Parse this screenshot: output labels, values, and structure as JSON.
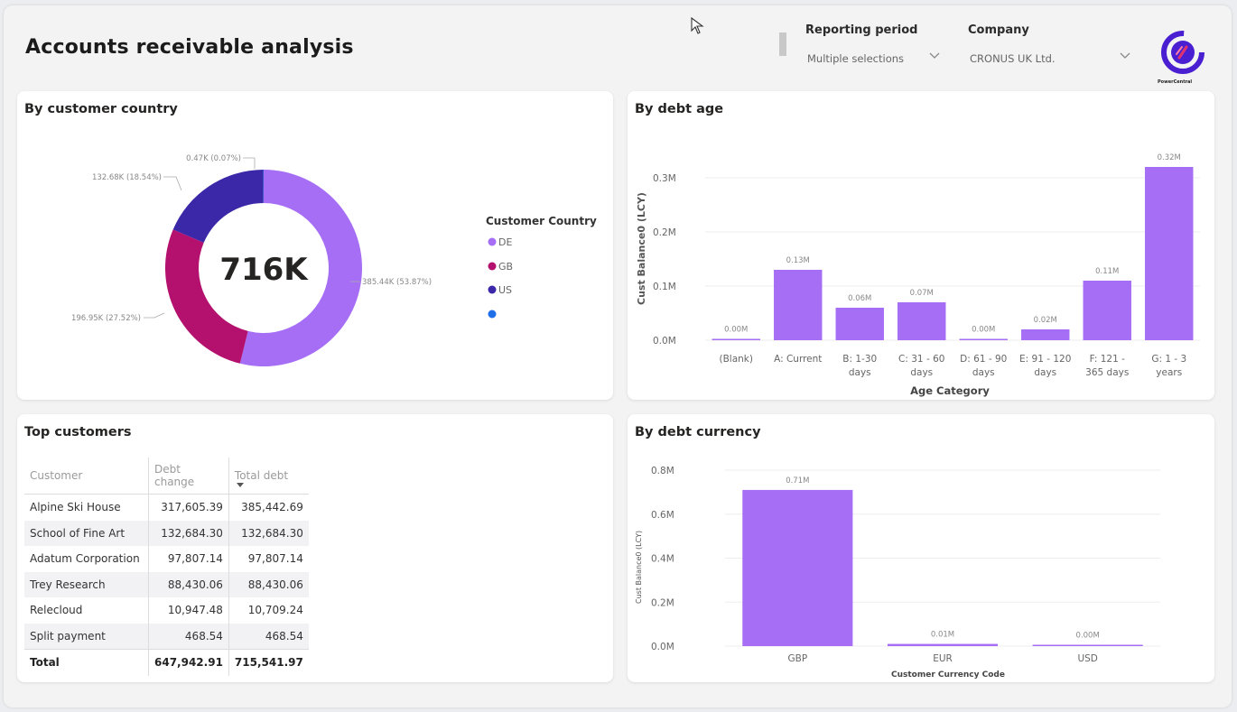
{
  "header": {
    "title": "Accounts receivable analysis",
    "reporting_period": {
      "label": "Reporting period",
      "value": "Multiple selections"
    },
    "company": {
      "label": "Company",
      "value": "CRONUS UK Ltd."
    },
    "logo_text": "PowerCentral"
  },
  "country_card": {
    "title": "By customer country",
    "center_value": "716K",
    "legend_title": "Customer Country",
    "legend": [
      {
        "label": "DE",
        "color": "#a66ef5"
      },
      {
        "label": "GB",
        "color": "#b4106e"
      },
      {
        "label": "US",
        "color": "#3b28a8"
      },
      {
        "label": "",
        "color": "#1e6fe8"
      }
    ],
    "slice_labels": {
      "de": "385.44K (53.87%)",
      "gb": "196.95K (27.52%)",
      "us": "132.68K (18.54%)",
      "other": "0.47K (0.07%)"
    }
  },
  "top_customers": {
    "title": "Top customers",
    "columns": [
      "Customer",
      "Debt change",
      "Total debt"
    ],
    "rows": [
      [
        "Alpine Ski House",
        "317,605.39",
        "385,442.69"
      ],
      [
        "School of Fine Art",
        "132,684.30",
        "132,684.30"
      ],
      [
        "Adatum Corporation",
        "97,807.14",
        "97,807.14"
      ],
      [
        "Trey Research",
        "88,430.06",
        "88,430.06"
      ],
      [
        "Relecloud",
        "10,947.48",
        "10,709.24"
      ],
      [
        "Split payment",
        "468.54",
        "468.54"
      ]
    ],
    "total": [
      "Total",
      "647,942.91",
      "715,541.97"
    ]
  },
  "chart_data": [
    {
      "type": "pie",
      "title": "By customer country",
      "categories": [
        "DE",
        "GB",
        "US",
        ""
      ],
      "values": [
        385.44,
        196.95,
        132.68,
        0.47
      ],
      "unit": "K",
      "colors": [
        "#a66ef5",
        "#b4106e",
        "#3b28a8",
        "#1e6fe8"
      ],
      "legend_title": "Customer Country",
      "legend_position": "right"
    },
    {
      "type": "bar",
      "title": "By debt age",
      "categories": [
        [
          "(Blank)"
        ],
        [
          "A: Current"
        ],
        [
          "B: 1-30",
          "days"
        ],
        [
          "C: 31 - 60",
          "days"
        ],
        [
          "D: 61 - 90",
          "days"
        ],
        [
          "E: 91 - 120",
          "days"
        ],
        [
          "F: 121 -",
          "365 days"
        ],
        [
          "G: 1 - 3",
          "years"
        ]
      ],
      "values": [
        0.0,
        0.13,
        0.06,
        0.07,
        0.0,
        0.02,
        0.11,
        0.32
      ],
      "data_labels": [
        "0.00M",
        "0.13M",
        "0.06M",
        "0.07M",
        "0.00M",
        "0.02M",
        "0.11M",
        "0.32M"
      ],
      "xlabel": "Age Category",
      "ylabel": "Cust Balance0 (LCY)",
      "yticks": [
        "0.0M",
        "0.1M",
        "0.2M",
        "0.3M"
      ],
      "ylim": [
        0,
        0.33
      ],
      "color": "#a66ef5",
      "grid": true
    },
    {
      "type": "bar",
      "title": "By debt currency",
      "categories": [
        [
          "GBP"
        ],
        [
          "EUR"
        ],
        [
          "USD"
        ]
      ],
      "values": [
        0.71,
        0.01,
        0.0
      ],
      "data_labels": [
        "0.71M",
        "0.01M",
        "0.00M"
      ],
      "xlabel": "Customer Currency Code",
      "ylabel": "Cust Balance0 (LCY)",
      "yticks": [
        "0.0M",
        "0.2M",
        "0.4M",
        "0.6M",
        "0.8M"
      ],
      "ylim": [
        0,
        0.8
      ],
      "color": "#a66ef5",
      "grid": true
    }
  ]
}
